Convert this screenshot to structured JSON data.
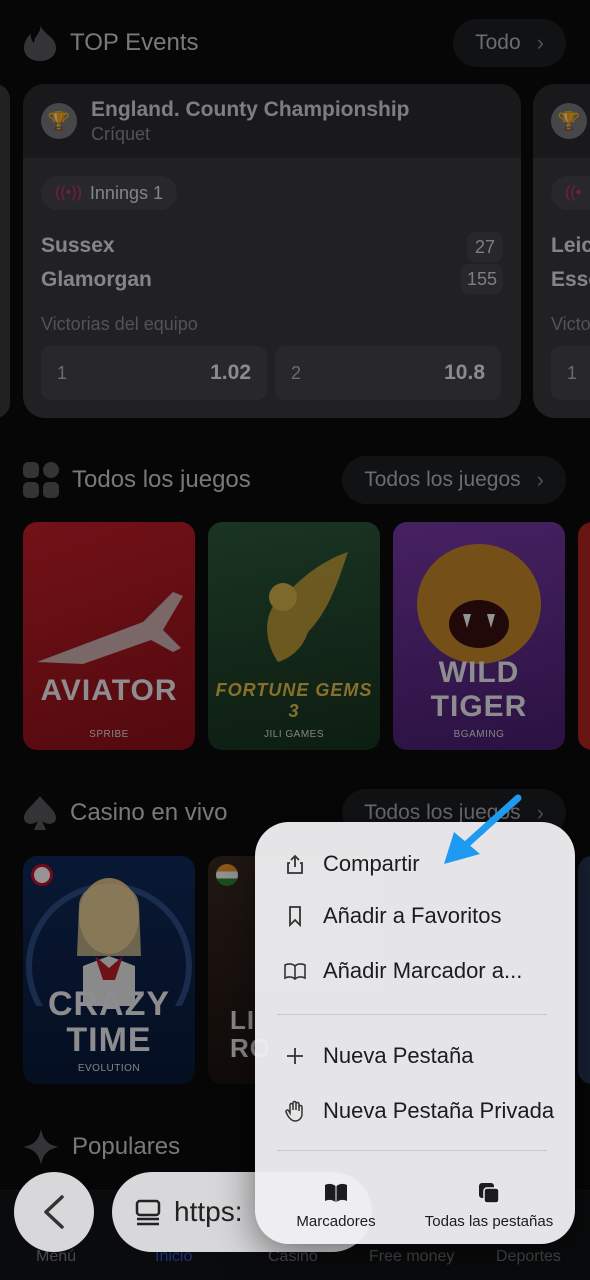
{
  "top_events": {
    "title": "TOP Events",
    "see_all": "Todo"
  },
  "event_card": {
    "league": "England. County Championship",
    "sport": "Críquet",
    "status": "Innings 1",
    "team1": "Sussex",
    "score1": "27",
    "team2": "Glamorgan",
    "score2": "155",
    "market": "Victorias del equipo",
    "odd1_key": "1",
    "odd1_val": "1.02",
    "odd2_key": "2",
    "odd2_val": "10.8"
  },
  "event_card_2": {
    "team1": "Leic",
    "team2": "Esse",
    "market": "Victo",
    "odd1_key": "1"
  },
  "all_games": {
    "title": "Todos los juegos",
    "see_all": "Todos los juegos"
  },
  "games": [
    {
      "name": "AVIATOR",
      "provider": "SPRIBE"
    },
    {
      "name": "FORTUNE GEMS 3",
      "provider": "JILI GAMES"
    },
    {
      "name": "WILD TIGER",
      "provider": "BGAMING"
    }
  ],
  "live_casino": {
    "title": "Casino en vivo",
    "see_all": "Todos los juegos"
  },
  "live_games": [
    {
      "name": "CRAZY TIME",
      "provider": "EVOLUTION"
    },
    {
      "name": "LI RO"
    }
  ],
  "popular": {
    "title": "Populares"
  },
  "bottom_nav": [
    "Menú",
    "Inicio",
    "Casino",
    "Free money",
    "Deportes"
  ],
  "browser": {
    "url": "https:"
  },
  "menu": {
    "items": [
      "Compartir",
      "Añadir a Favoritos",
      "Añadir Marcador a...",
      "Nueva Pestaña",
      "Nueva Pestaña Privada"
    ],
    "bottom_left": "Marcadores",
    "bottom_right": "Todas las pestañas"
  },
  "colors": {
    "accent": "#2f55d6",
    "live": "#d03268",
    "arrow": "#1e9bf0"
  }
}
